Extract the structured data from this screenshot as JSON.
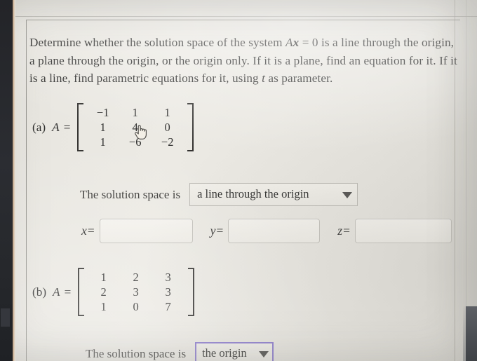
{
  "problem": {
    "prompt_part1": "Determine whether the solution space of the system ",
    "prompt_matrix_var": "A",
    "prompt_vector_var": "x",
    "prompt_equals_zero": " = 0",
    "prompt_part2": " is a line through the origin, a plane through the origin, or the origin only. If it is a plane, find an equation for it. If it is a line, find parametric equations for it, using ",
    "prompt_param_var": "t",
    "prompt_part3": " as parameter."
  },
  "parts": [
    {
      "id": "a",
      "label": "(a)",
      "equation_lhs": "A =",
      "matrix": [
        [
          "−1",
          "1",
          "1"
        ],
        [
          "1",
          "4",
          "0"
        ],
        [
          "1",
          "−6",
          "−2"
        ]
      ],
      "solution_prompt": "The solution space is",
      "dropdown_value": "a line through the origin",
      "dropdown_focused": false,
      "answer_inputs": [
        {
          "var": "x",
          "operator": "=",
          "value": ""
        },
        {
          "var": "y",
          "operator": "=",
          "value": ""
        },
        {
          "var": "z",
          "operator": "=",
          "value": ""
        }
      ]
    },
    {
      "id": "b",
      "label": "(b)",
      "equation_lhs": "A =",
      "matrix": [
        [
          "1",
          "2",
          "3"
        ],
        [
          "2",
          "3",
          "3"
        ],
        [
          "1",
          "0",
          "7"
        ]
      ],
      "solution_prompt": "The solution space is",
      "dropdown_value": "the origin",
      "dropdown_focused": true
    }
  ],
  "colors": {
    "page_background": "#e9e7e1",
    "text": "#2f2f2e",
    "input_border": "#c2c0ba",
    "dropdown_border": "#b9b7b1",
    "dropdown_focus_border": "#8a79cd",
    "bezel": "#26282c"
  },
  "cursor": {
    "icon": "pointing-hand-cursor"
  }
}
